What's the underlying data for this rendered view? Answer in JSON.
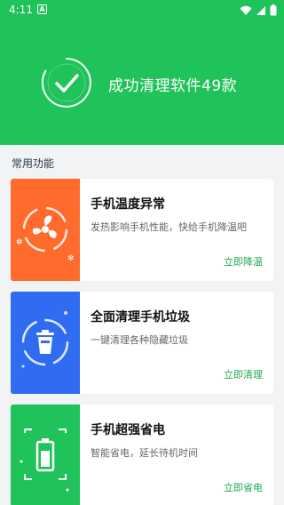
{
  "status": {
    "time": "4:11",
    "notification_letter": "A"
  },
  "banner": {
    "success_text": "成功清理软件49款"
  },
  "section": {
    "title": "常用功能"
  },
  "cards": [
    {
      "title": "手机温度异常",
      "desc": "发热影响手机性能，快给手机降温吧",
      "action": "立即降温",
      "icon": "fan-icon",
      "color": "#ff6a2d"
    },
    {
      "title": "全面清理手机垃圾",
      "desc": "一键清理各种隐藏垃圾",
      "action": "立即清理",
      "icon": "trash-icon",
      "color": "#2f6cf2"
    },
    {
      "title": "手机超强省电",
      "desc": "智能省电，延长待机时间",
      "action": "立即省电",
      "icon": "battery-icon",
      "color": "#20c25a"
    }
  ]
}
